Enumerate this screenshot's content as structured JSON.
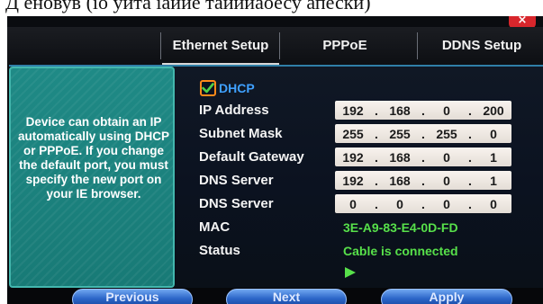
{
  "caption": "Д еновув (іо уита іаиие таиииаоесу апески)",
  "window": {
    "close_glyph": "×"
  },
  "tabs": [
    {
      "label": "Ethernet Setup",
      "active": true
    },
    {
      "label": "PPPoE",
      "active": false
    },
    {
      "label": "DDNS Setup",
      "active": false
    }
  ],
  "help_text": "Device can obtain an IP automatically using DHCP or PPPoE. If you change the default port, you must specify the new port on your IE browser.",
  "dhcp": {
    "label": "DHCP",
    "checked": true,
    "check_color": "#4fd14a",
    "box_color": "#ff8a1a"
  },
  "fields": {
    "ip_address": {
      "label": "IP Address",
      "octets": [
        "192",
        "168",
        "0",
        "200"
      ]
    },
    "subnet_mask": {
      "label": "Subnet Mask",
      "octets": [
        "255",
        "255",
        "255",
        "0"
      ]
    },
    "default_gateway": {
      "label": "Default Gateway",
      "octets": [
        "192",
        "168",
        "0",
        "1"
      ]
    },
    "dns_server_1": {
      "label": "DNS Server",
      "octets": [
        "192",
        "168",
        "0",
        "1"
      ]
    },
    "dns_server_2": {
      "label": "DNS Server",
      "octets": [
        "0",
        "0",
        "0",
        "0"
      ]
    }
  },
  "mac": {
    "label": "MAC",
    "value": "3E-A9-83-E4-0D-FD"
  },
  "status": {
    "label": "Status",
    "value": "Cable is connected"
  },
  "buttons": {
    "previous": "Previous",
    "next": "Next",
    "apply": "Apply"
  },
  "colors": {
    "accent_green": "#57e04a",
    "tab_text": "#f2f2f2",
    "button_blue": "#2c66c8",
    "help_panel": "#1f8a86"
  }
}
